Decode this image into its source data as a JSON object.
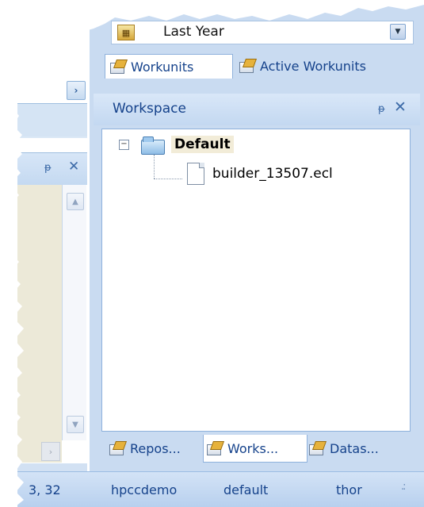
{
  "toolbar": {
    "date_filter": "Last Year"
  },
  "tabs_top": [
    {
      "label": "Workunits"
    },
    {
      "label": "Active Workunits"
    }
  ],
  "workspace": {
    "title": "Workspace",
    "pin_glyph": "ᵽ",
    "close_glyph": "✕",
    "tree": {
      "root_label": "Default",
      "expander_glyph": "−",
      "children": [
        {
          "label": "builder_13507.ecl"
        }
      ]
    }
  },
  "left_panel": {
    "scroll_right_glyph": "›",
    "pin_glyph": "ᵽ",
    "close_glyph": "✕",
    "scroll_up_glyph": "▲",
    "scroll_down_glyph": "▼",
    "scroll_left_glyph": "›"
  },
  "tabs_bottom": [
    {
      "label": "Repos..."
    },
    {
      "label": "Works..."
    },
    {
      "label": "Datas..."
    }
  ],
  "status_bar": {
    "position": "3, 32",
    "server": "hpccdemo",
    "queue": "default",
    "cluster": "thor",
    "grip_glyph": ".:"
  },
  "icons": {
    "calendar": "calendar-icon",
    "tab": "workunit-tab-icon",
    "folder": "folder-icon",
    "file": "file-icon"
  }
}
